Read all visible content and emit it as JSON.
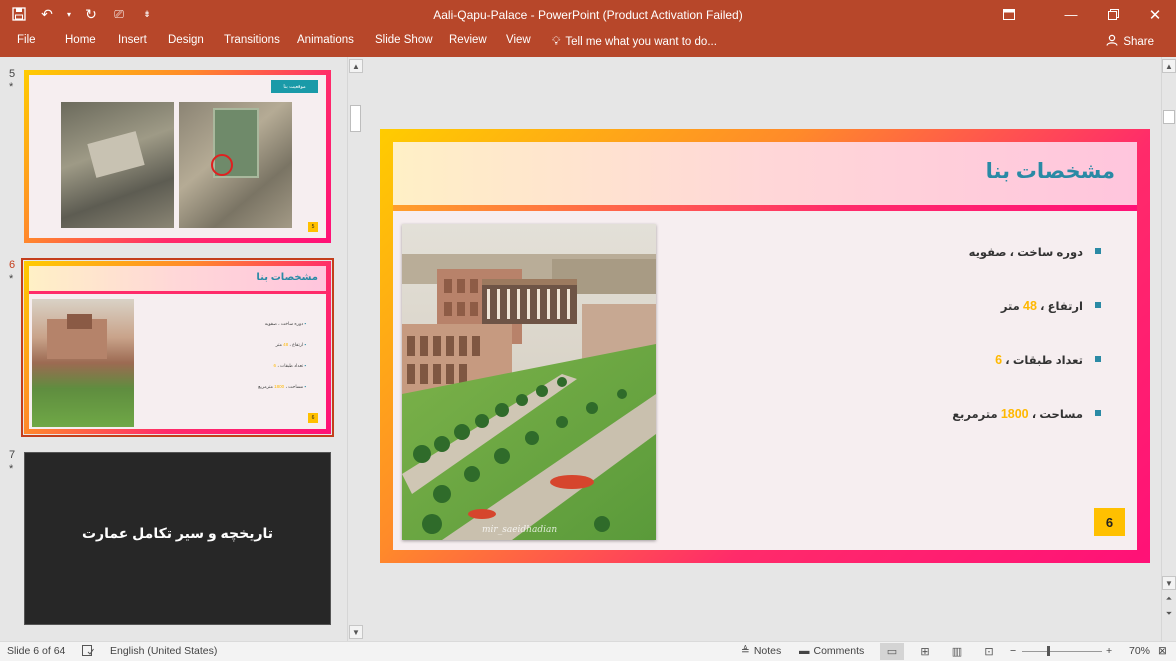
{
  "window": {
    "title": "Aali-Qapu-Palace - PowerPoint (Product Activation Failed)"
  },
  "ribbon": {
    "tabs": [
      "File",
      "Home",
      "Insert",
      "Design",
      "Transitions",
      "Animations",
      "Slide Show",
      "Review",
      "View"
    ],
    "tellme": "Tell me what you want to do...",
    "share": "Share"
  },
  "thumbnails": [
    {
      "number": "5",
      "star": "*",
      "header_button": "موقعیت بنا",
      "page": "5"
    },
    {
      "number": "6",
      "star": "*",
      "title": "مشخصات بنا",
      "page": "6",
      "bullets": [
        {
          "text": "دوره ساخت ، صفویه",
          "num": ""
        },
        {
          "text": "ارتفاع ، ",
          "num": "48",
          "tail": " متر"
        },
        {
          "text": "تعداد طبقات ، ",
          "num": "6",
          "tail": ""
        },
        {
          "text": "مساحت ، ",
          "num": "1800",
          "tail": " مترمربع"
        }
      ]
    },
    {
      "number": "7",
      "star": "*",
      "title": "تاریخچه و سیر تکامل عمارت"
    }
  ],
  "slide": {
    "title": "مشخصات بنا",
    "page": "6",
    "photo_caption": "mir_saeidhadian",
    "bullets": [
      {
        "text": "دوره ساخت ، صفویه",
        "num": "",
        "tail": ""
      },
      {
        "text": "ارتفاع ، ",
        "num": "48",
        "tail": " متر"
      },
      {
        "text": "تعداد طبقات ، ",
        "num": "6",
        "tail": ""
      },
      {
        "text": "مساحت ، ",
        "num": "1800",
        "tail": " مترمربع"
      }
    ]
  },
  "statusbar": {
    "slide_info": "Slide 6 of 64",
    "language": "English (United States)",
    "notes": "Notes",
    "comments": "Comments",
    "zoom": "70%"
  },
  "colors": {
    "brand": "#b7472a",
    "accent_teal": "#2a8aa5",
    "accent_yellow": "#ffc000",
    "frame_pink": "#ff1177"
  }
}
